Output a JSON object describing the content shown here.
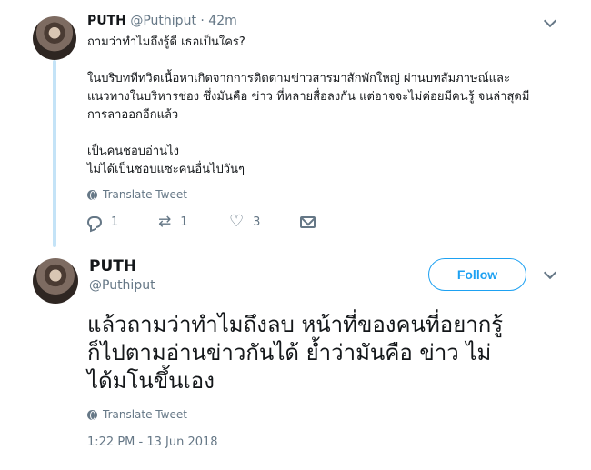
{
  "reply_tweet": {
    "display_name": "PUTH",
    "handle": "@Puthiput",
    "separator": "·",
    "age": "42m",
    "text_line_1": "ถามว่าทำไมถึงรู้ดี เธอเป็นใคร?",
    "text_line_2": "ในบริบททีทวิตเนื้อหาเกิดจากการติดตามข่าวสารมาสักพักใหญ่ ผ่านบทสัมภาษณ์และ",
    "text_line_3": "แนวทางในบริหารช่อง ซึ่งมันคือ ข่าว ที่หลายสื่อลงกัน แต่อาจจะไม่ค่อยมีคนรู้ จนล่าสุดมี",
    "text_line_4": "การลาออกอีกแล้ว",
    "text_line_5": "เป็นคนชอบอ่านไง",
    "text_line_6": "ไม่ได้เป็นชอบแซะคนอื่นไปวันๆ",
    "translate_label": "Translate Tweet",
    "reply_count": "1",
    "retweet_count": "1",
    "like_count": "3",
    "icons": {
      "reply": "reply-icon",
      "retweet": "retweet-icon",
      "like": "heart-icon",
      "dm": "mail-icon",
      "menu": "chevron-down-icon"
    }
  },
  "main_tweet": {
    "display_name": "PUTH",
    "handle": "@Puthiput",
    "follow_label": "Follow",
    "text_line_1": "แล้วถามว่าทำไมถึงลบ หน้าที่ของคนที่อยากรู้",
    "text_line_2": "ก็ไปตามอ่านข่าวกันได้  ย้ำว่ามันคือ ข่าว ไม่",
    "text_line_3": "ได้มโนขึ้นเอง",
    "translate_label": "Translate Tweet",
    "timestamp": "1:22 PM - 13 Jun 2018"
  },
  "colors": {
    "accent": "#1da1f2",
    "muted_text": "#657786",
    "thread_line": "#c4e3f7"
  }
}
